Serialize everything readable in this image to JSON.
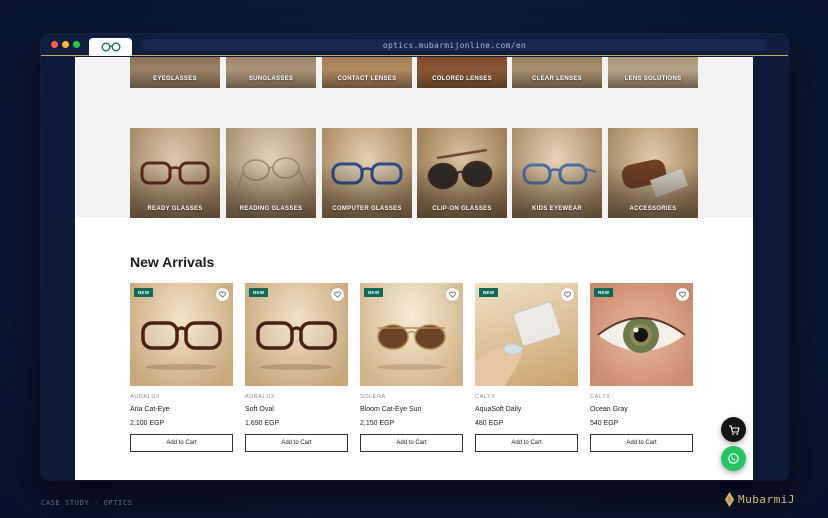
{
  "browser": {
    "url": "optics.mubarmijonline.com/en",
    "tab_icon": "glasses-icon"
  },
  "categories_top": [
    {
      "label": "EYEGLASSES"
    },
    {
      "label": "SUNGLASSES"
    },
    {
      "label": "CONTACT LENSES"
    },
    {
      "label": "COLORED LENSES"
    },
    {
      "label": "CLEAR LENSES"
    },
    {
      "label": "LENS SOLUTIONS"
    }
  ],
  "categories_bottom": [
    {
      "label": "READY GLASSES"
    },
    {
      "label": "READING GLASSES"
    },
    {
      "label": "COMPUTER GLASSES"
    },
    {
      "label": "CLIP-ON GLASSES"
    },
    {
      "label": "KIDS EYEWEAR"
    },
    {
      "label": "ACCESSORIES"
    }
  ],
  "new_arrivals": {
    "title": "New Arrivals",
    "badge": "NEW",
    "add_label": "Add to Cart",
    "products": [
      {
        "brand": "AURALUX",
        "name": "Aria Cat-Eye",
        "price": "2,100 EGP"
      },
      {
        "brand": "AURALUX",
        "name": "Soft Oval",
        "price": "1,690 EGP"
      },
      {
        "brand": "SOLERA",
        "name": "Bloom Cat-Eye Sun",
        "price": "2,150 EGP"
      },
      {
        "brand": "CALYX",
        "name": "AquaSoft Daily",
        "price": "480 EGP"
      },
      {
        "brand": "CALYX",
        "name": "Ocean Gray",
        "price": "540 EGP"
      }
    ]
  },
  "footer": {
    "caption": "CASE STUDY · OPTICS",
    "logo_text": "MubarmiJ"
  },
  "colors": {
    "badge_green": "#0f6b57",
    "whatsapp": "#25c462",
    "gold": "#d9b878",
    "page_bg": "#0b1733"
  }
}
